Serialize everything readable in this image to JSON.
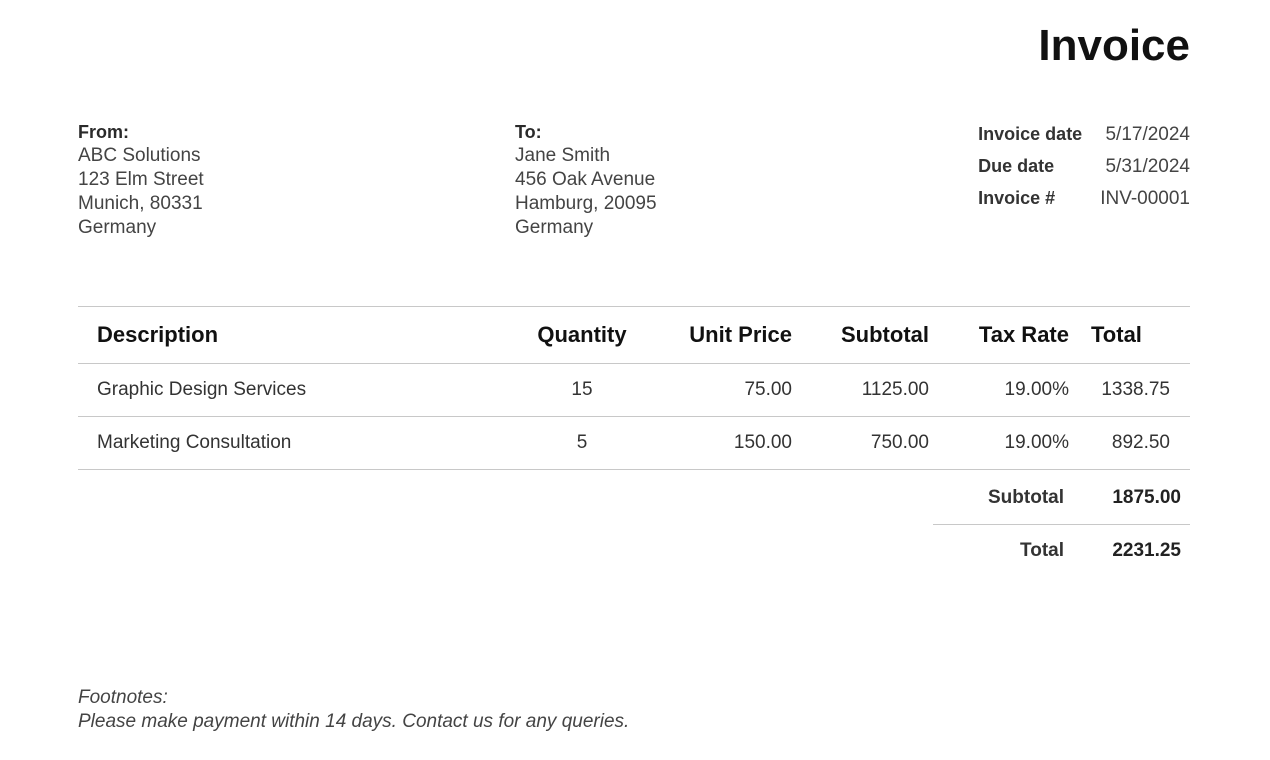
{
  "title": "Invoice",
  "from": {
    "label": "From:",
    "lines": [
      "ABC Solutions",
      "123 Elm Street",
      "Munich, 80331",
      "Germany"
    ]
  },
  "to": {
    "label": "To:",
    "lines": [
      "Jane Smith",
      "456 Oak Avenue",
      "Hamburg, 20095",
      "Germany"
    ]
  },
  "meta": [
    {
      "label": "Invoice date",
      "value": "5/17/2024"
    },
    {
      "label": "Due date",
      "value": "5/31/2024"
    },
    {
      "label": "Invoice #",
      "value": "INV-00001"
    }
  ],
  "table": {
    "headers": [
      "Description",
      "Quantity",
      "Unit Price",
      "Subtotal",
      "Tax Rate",
      "Total"
    ],
    "rows": [
      [
        "Graphic Design Services",
        "15",
        "75.00",
        "1125.00",
        "19.00%",
        "1338.75"
      ],
      [
        "Marketing Consultation",
        "5",
        "150.00",
        "750.00",
        "19.00%",
        "892.50"
      ]
    ]
  },
  "summary": {
    "subtotal_label": "Subtotal",
    "subtotal_value": "1875.00",
    "total_label": "Total",
    "total_value": "2231.25"
  },
  "footnotes": {
    "label": "Footnotes:",
    "text": "Please make payment within 14 days. Contact us for any queries."
  }
}
